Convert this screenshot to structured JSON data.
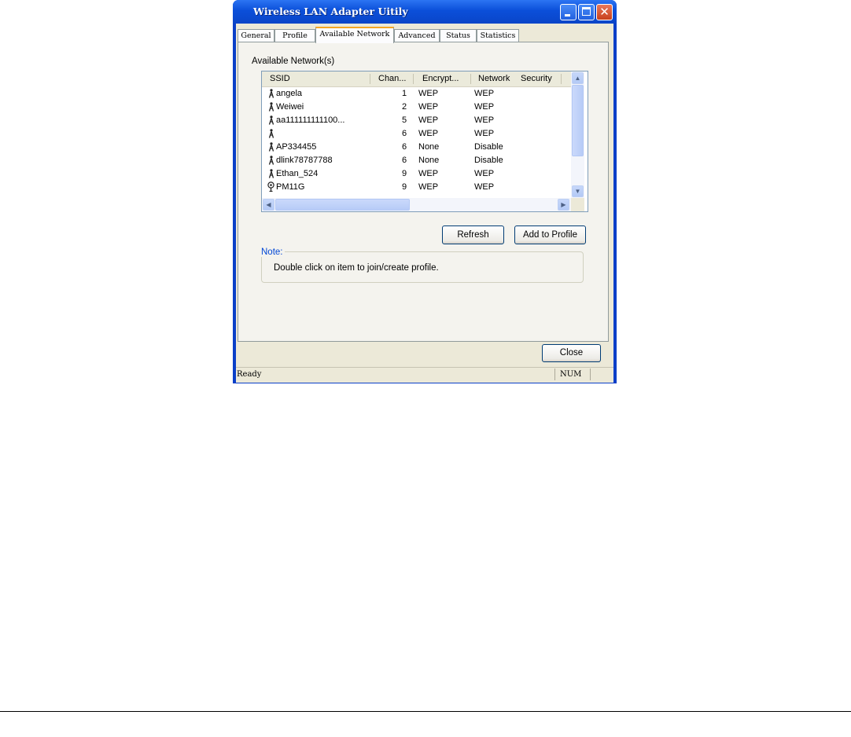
{
  "window": {
    "title": "Wireless LAN Adapter Uitily",
    "controls": {
      "minimize": "minimize",
      "maximize": "maximize",
      "close": "✕"
    }
  },
  "tabs": [
    {
      "label": "General"
    },
    {
      "label": "Profile"
    },
    {
      "label": "Available Network",
      "active": true
    },
    {
      "label": "Advanced"
    },
    {
      "label": "Status"
    },
    {
      "label": "Statistics"
    }
  ],
  "available_network": {
    "group_label": "Available Network(s)",
    "columns": [
      "SSID",
      "Chan...",
      "Encrypt...",
      "Network",
      "Security"
    ],
    "rows": [
      {
        "ssid": "angela",
        "channel": "1",
        "encryption": "WEP",
        "network": "WEP",
        "icon": "access-point-icon"
      },
      {
        "ssid": "Weiwei",
        "channel": "2",
        "encryption": "WEP",
        "network": "WEP",
        "icon": "access-point-icon"
      },
      {
        "ssid": "aa111111111100...",
        "channel": "5",
        "encryption": "WEP",
        "network": "WEP",
        "icon": "access-point-icon"
      },
      {
        "ssid": "",
        "channel": "6",
        "encryption": "WEP",
        "network": "WEP",
        "icon": "access-point-icon"
      },
      {
        "ssid": "AP334455",
        "channel": "6",
        "encryption": "None",
        "network": "Disable",
        "icon": "access-point-icon"
      },
      {
        "ssid": "dlink78787788",
        "channel": "6",
        "encryption": "None",
        "network": "Disable",
        "icon": "access-point-icon"
      },
      {
        "ssid": "Ethan_524",
        "channel": "9",
        "encryption": "WEP",
        "network": "WEP",
        "icon": "access-point-icon"
      },
      {
        "ssid": "PM11G",
        "channel": "9",
        "encryption": "WEP",
        "network": "WEP",
        "icon": "connected-antenna-icon"
      }
    ],
    "refresh_label": "Refresh",
    "add_to_profile_label": "Add to Profile",
    "note_title": "Note:",
    "note_text": "Double click on item to join/create profile."
  },
  "footer": {
    "close_label": "Close"
  },
  "statusbar": {
    "left": "Ready",
    "num": "NUM"
  },
  "colors": {
    "title_blue": "#0a4fd9",
    "note_blue": "#0046d5",
    "tab_accent": "#f5a623",
    "dialog_bg": "#ece9d8"
  }
}
